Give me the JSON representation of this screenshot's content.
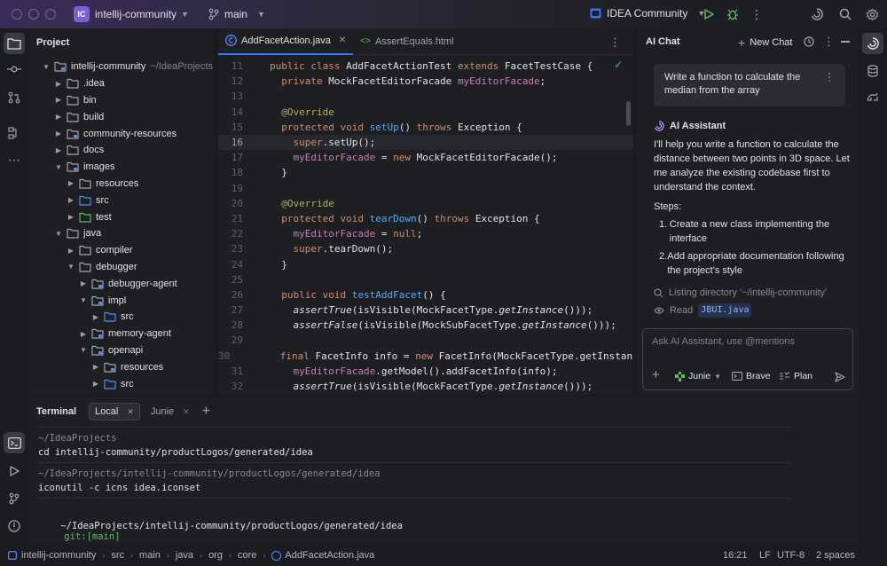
{
  "titlebar": {
    "project_badge": "IC",
    "project_name": "intellij-community",
    "branch": "main",
    "run_config": "IDEA Community"
  },
  "project_panel": {
    "title": "Project",
    "tree": [
      {
        "label": "intellij-community",
        "hint": "~/IdeaProjects",
        "depth": 0,
        "expanded": true,
        "type": "module"
      },
      {
        "label": ".idea",
        "depth": 1,
        "expanded": false,
        "type": "folder"
      },
      {
        "label": "bin",
        "depth": 1,
        "expanded": false,
        "type": "folder"
      },
      {
        "label": "build",
        "depth": 1,
        "expanded": false,
        "type": "folder"
      },
      {
        "label": "community-resources",
        "depth": 1,
        "expanded": false,
        "type": "module"
      },
      {
        "label": "docs",
        "depth": 1,
        "expanded": false,
        "type": "folder"
      },
      {
        "label": "images",
        "depth": 1,
        "expanded": true,
        "type": "module"
      },
      {
        "label": "resources",
        "depth": 2,
        "expanded": false,
        "type": "folder"
      },
      {
        "label": "src",
        "depth": 2,
        "expanded": false,
        "type": "src"
      },
      {
        "label": "test",
        "depth": 2,
        "expanded": false,
        "type": "test"
      },
      {
        "label": "java",
        "depth": 1,
        "expanded": true,
        "type": "folder"
      },
      {
        "label": "compiler",
        "depth": 2,
        "expanded": false,
        "type": "folder"
      },
      {
        "label": "debugger",
        "depth": 2,
        "expanded": true,
        "type": "folder"
      },
      {
        "label": "debugger-agent",
        "depth": 3,
        "expanded": false,
        "type": "module"
      },
      {
        "label": "impl",
        "depth": 3,
        "expanded": true,
        "type": "module"
      },
      {
        "label": "src",
        "depth": 4,
        "expanded": false,
        "type": "src"
      },
      {
        "label": "memory-agent",
        "depth": 3,
        "expanded": false,
        "type": "module"
      },
      {
        "label": "openapi",
        "depth": 3,
        "expanded": true,
        "type": "module"
      },
      {
        "label": "resources",
        "depth": 4,
        "expanded": false,
        "type": "module"
      },
      {
        "label": "src",
        "depth": 4,
        "expanded": false,
        "type": "src"
      }
    ]
  },
  "editor": {
    "tabs": [
      {
        "label": "AddFacetAction.java",
        "active": true
      },
      {
        "label": "AssertEquals.html",
        "active": false
      }
    ],
    "current_line": 16,
    "lines": [
      {
        "n": "11",
        "tokens": [
          [
            "kw",
            "public class "
          ],
          [
            "",
            "AddFacetActionTest "
          ],
          [
            "kw",
            "extends "
          ],
          [
            "",
            "FacetTestCase {"
          ]
        ]
      },
      {
        "n": "12",
        "tokens": [
          [
            "",
            "  "
          ],
          [
            "kw",
            "private "
          ],
          [
            "",
            "MockFacetEditorFacade "
          ],
          [
            "fld",
            "myEditorFacade"
          ],
          [
            "",
            ";"
          ]
        ]
      },
      {
        "n": "13",
        "tokens": []
      },
      {
        "n": "14",
        "tokens": [
          [
            "",
            "  "
          ],
          [
            "ann",
            "@Override"
          ]
        ]
      },
      {
        "n": "15",
        "tokens": [
          [
            "",
            "  "
          ],
          [
            "kw",
            "protected void "
          ],
          [
            "fn",
            "setUp"
          ],
          [
            "",
            "() "
          ],
          [
            "kw",
            "throws "
          ],
          [
            "",
            "Exception {"
          ]
        ]
      },
      {
        "n": "16",
        "tokens": [
          [
            "",
            "    "
          ],
          [
            "kw",
            "super"
          ],
          [
            "",
            ".setUp();"
          ]
        ]
      },
      {
        "n": "17",
        "tokens": [
          [
            "",
            "    "
          ],
          [
            "fld",
            "myEditorFacade"
          ],
          [
            "",
            " = "
          ],
          [
            "kw",
            "new "
          ],
          [
            "",
            "MockFacetEditorFacade();"
          ]
        ]
      },
      {
        "n": "18",
        "tokens": [
          [
            "",
            "  }"
          ]
        ]
      },
      {
        "n": "19",
        "tokens": []
      },
      {
        "n": "20",
        "tokens": [
          [
            "",
            "  "
          ],
          [
            "ann",
            "@Override"
          ]
        ]
      },
      {
        "n": "21",
        "tokens": [
          [
            "",
            "  "
          ],
          [
            "kw",
            "protected void "
          ],
          [
            "fn",
            "tearDown"
          ],
          [
            "",
            "() "
          ],
          [
            "kw",
            "throws "
          ],
          [
            "",
            "Exception {"
          ]
        ]
      },
      {
        "n": "22",
        "tokens": [
          [
            "",
            "    "
          ],
          [
            "fld",
            "myEditorFacade"
          ],
          [
            "",
            " = "
          ],
          [
            "kw",
            "null"
          ],
          [
            "",
            ";"
          ]
        ]
      },
      {
        "n": "23",
        "tokens": [
          [
            "",
            "    "
          ],
          [
            "kw",
            "super"
          ],
          [
            "",
            ".tearDown();"
          ]
        ]
      },
      {
        "n": "24",
        "tokens": [
          [
            "",
            "  }"
          ]
        ]
      },
      {
        "n": "25",
        "tokens": []
      },
      {
        "n": "26",
        "tokens": [
          [
            "",
            "  "
          ],
          [
            "kw",
            "public void "
          ],
          [
            "fn",
            "testAddFacet"
          ],
          [
            "",
            "() {"
          ]
        ]
      },
      {
        "n": "27",
        "tokens": [
          [
            "",
            "    "
          ],
          [
            "it",
            "assertTrue"
          ],
          [
            "",
            "(isVisible(MockFacetType."
          ],
          [
            "it",
            "getInstance"
          ],
          [
            "",
            "()));"
          ]
        ]
      },
      {
        "n": "28",
        "tokens": [
          [
            "",
            "    "
          ],
          [
            "it",
            "assertFalse"
          ],
          [
            "",
            "(isVisible(MockSubFacetType."
          ],
          [
            "it",
            "getInstance"
          ],
          [
            "",
            "()));"
          ]
        ]
      },
      {
        "n": "29",
        "tokens": []
      },
      {
        "n": "30",
        "tokens": [
          [
            "",
            "    "
          ],
          [
            "kw",
            "final "
          ],
          [
            "",
            "FacetInfo info = "
          ],
          [
            "kw",
            "new "
          ],
          [
            "",
            "FacetInfo(MockFacetType.getInstance("
          ]
        ]
      },
      {
        "n": "31",
        "tokens": [
          [
            "",
            "    "
          ],
          [
            "fld",
            "myEditorFacade"
          ],
          [
            "",
            ".getModel().addFacetInfo(info);"
          ]
        ]
      },
      {
        "n": "32",
        "tokens": [
          [
            "",
            "    "
          ],
          [
            "it",
            "assertTrue"
          ],
          [
            "",
            "(isVisible(MockFacetType."
          ],
          [
            "it",
            "getInstance"
          ],
          [
            "",
            "()));"
          ]
        ]
      }
    ]
  },
  "ai_chat": {
    "title": "AI Chat",
    "new_chat_label": "New Chat",
    "user_message": "Write a function to calculate the median from the array",
    "assistant_name": "AI Assistant",
    "response_intro": "I'll help you write a function to calculate the distance between two points in 3D space. Let me analyze the existing codebase first to understand the context.",
    "steps_label": "Steps:",
    "steps": [
      "Create a new class implementing the interface",
      "Add appropriate documentation following the project's style"
    ],
    "tool_listing": "Listing directory '~/intellij-community'",
    "tool_read_prefix": "Read",
    "tool_read_file": "JBUI.java",
    "input_placeholder": "Ask AI Assistant, use @mentions",
    "agent_label": "Junie",
    "brave_label": "Brave",
    "plan_label": "Plan"
  },
  "terminal": {
    "title": "Terminal",
    "tabs": [
      "Local",
      "Junie"
    ],
    "blocks": [
      {
        "path": "~/IdeaProjects",
        "command": "cd intellij-community/productLogos/generated/idea"
      },
      {
        "path": "~/IdeaProjects/intellij-community/productLogos/generated/idea",
        "command": "iconutil -c icns idea.iconset"
      }
    ],
    "prompt_path": "~/IdeaProjects/intellij-community/productLogos/generated/idea",
    "prompt_git": "git:[main]"
  },
  "statusbar": {
    "breadcrumbs": [
      "intellij-community",
      "src",
      "main",
      "java",
      "org",
      "core",
      "AddFacetAction.java"
    ],
    "position": "16:21",
    "line_sep": "LF",
    "encoding": "UTF-8",
    "indent": "2 spaces"
  },
  "colors": {
    "accent": "#3574f0",
    "keyword": "#cf8e6d",
    "function": "#56a8f5",
    "field": "#c77dba",
    "annotation": "#b3ae60",
    "success": "#5fb865"
  }
}
